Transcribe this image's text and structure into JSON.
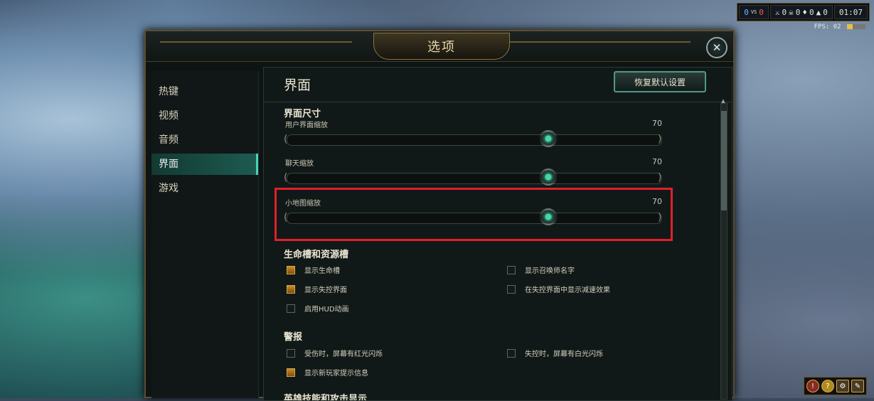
{
  "hud": {
    "score_blue": "0",
    "score_sep": "VS",
    "score_red": "0",
    "kills": "0",
    "deaths": "0",
    "assists": "0",
    "cs": "0",
    "time": "01:07",
    "fps_label": "FPS:",
    "fps_value": "02",
    "icons": [
      "sword-icon",
      "skull-icon",
      "gold-icon",
      "minion-icon"
    ]
  },
  "window": {
    "title": "选项",
    "close_label": "✕"
  },
  "sidebar": {
    "items": [
      {
        "label": "热键",
        "active": false
      },
      {
        "label": "视频",
        "active": false
      },
      {
        "label": "音频",
        "active": false
      },
      {
        "label": "界面",
        "active": true
      },
      {
        "label": "游戏",
        "active": false
      }
    ]
  },
  "content": {
    "title": "界面",
    "reset_label": "恢复默认设置",
    "size_group": "界面尺寸",
    "sliders": [
      {
        "label": "用户界面缩放",
        "value": "70",
        "fraction": 0.7
      },
      {
        "label": "聊天缩放",
        "value": "70",
        "fraction": 0.7
      },
      {
        "label": "小地图缩放",
        "value": "70",
        "fraction": 0.7
      }
    ],
    "hp_group": "生命槽和资源槽",
    "hp_options": [
      {
        "label": "显示生命槽",
        "checked": true
      },
      {
        "label": "显示召唤师名字",
        "checked": false
      },
      {
        "label": "显示失控界面",
        "checked": true
      },
      {
        "label": "在失控界面中显示减速效果",
        "checked": false
      },
      {
        "label": "启用HUD动画",
        "checked": false
      }
    ],
    "alert_group": "警报",
    "alert_options": [
      {
        "label": "受伤时，屏幕有红光闪烁",
        "checked": false
      },
      {
        "label": "失控时，屏幕有白光闪烁",
        "checked": false
      },
      {
        "label": "显示新玩家提示信息",
        "checked": true
      }
    ],
    "next_group": "英雄技能和攻击显示"
  },
  "colors": {
    "accent": "#48d2b8",
    "highlight": "#e0202a",
    "checked": "#c88a2a"
  }
}
